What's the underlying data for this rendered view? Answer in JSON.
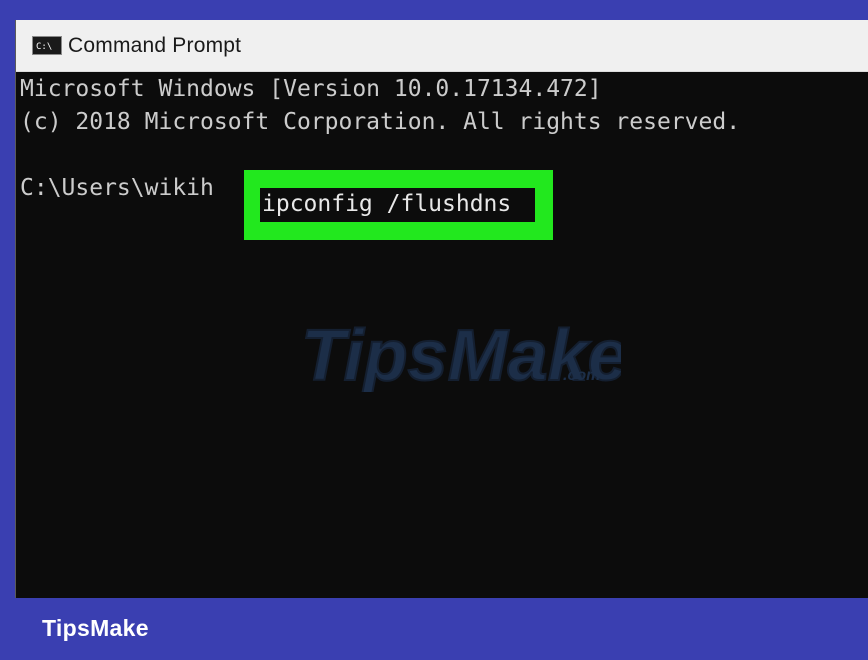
{
  "window": {
    "title": "Command Prompt",
    "icon": "cmd-console-icon"
  },
  "console": {
    "line1": "Microsoft Windows [Version 10.0.17134.472]",
    "line2": "(c) 2018 Microsoft Corporation. All rights reserved.",
    "prompt": "C:\\Users\\wikih",
    "command": "ipconfig /flushdns"
  },
  "watermark": {
    "text": "TipsMake",
    "suffix": ".com"
  },
  "footer": {
    "brand": "TipsMake"
  },
  "colors": {
    "frame": "#3a3fb1",
    "console_bg": "#0c0c0c",
    "console_text": "#cccccc",
    "highlight": "#22e81e",
    "titlebar": "#f0f0f0"
  }
}
